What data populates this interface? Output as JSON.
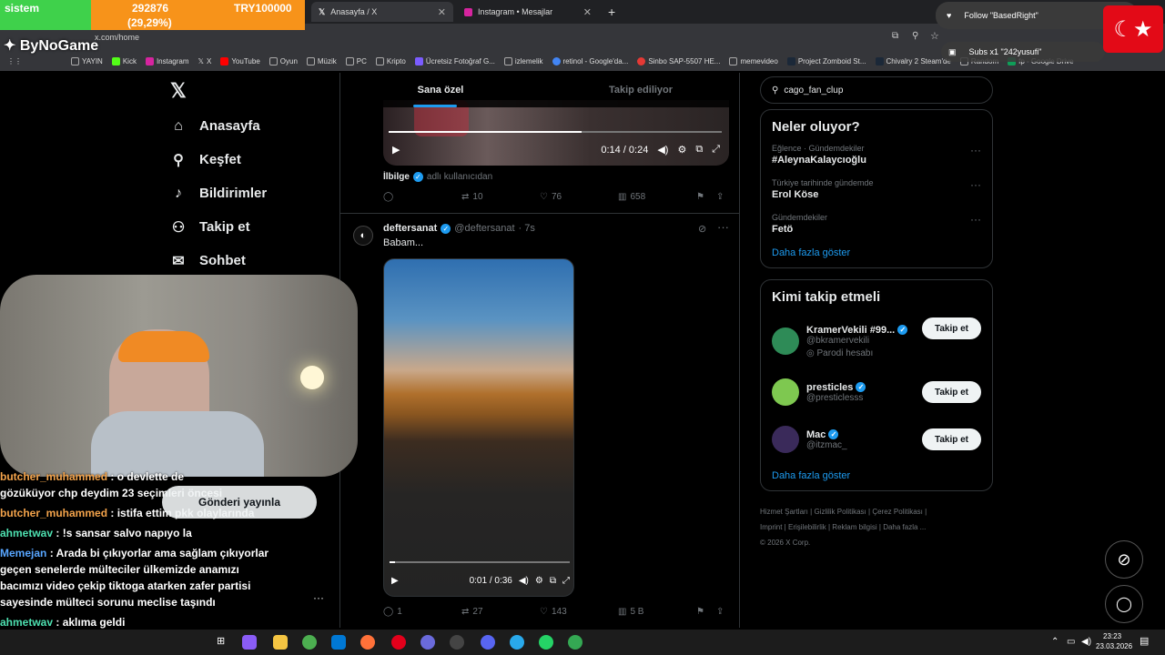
{
  "browser": {
    "tabs": [
      {
        "label": "Anasayfa / X",
        "active": true
      },
      {
        "label": "Instagram • Mesajlar",
        "active": false
      }
    ],
    "url": "x.com/home",
    "bookmarks": [
      "YAYIN",
      "Kick",
      "Instagram",
      "X",
      "YouTube",
      "Oyun",
      "Müzik",
      "PC",
      "Kripto",
      "Ücretsiz Fotoğraf G...",
      "izlemelik",
      "retinol - Google'da...",
      "Sinbo SAP-5507 HE...",
      "memevideo",
      "Project Zomboid St...",
      "Chivalry 2 Steam'de",
      "Random",
      "fp - Google Drive"
    ]
  },
  "overlay": {
    "ticker_label": "sistem",
    "ticker_value": "292876",
    "ticker_percent": "(29,29%)",
    "ticker_goal": "TRY100000",
    "channel": "ByNoGame",
    "follow_alert": "Follow \"BasedRight\"",
    "subs_alert": "Subs x1 \"242yusufi\""
  },
  "nav": {
    "items": [
      {
        "label": "Anasayfa",
        "icon": "home-icon"
      },
      {
        "label": "Keşfet",
        "icon": "search-icon"
      },
      {
        "label": "Bildirimler",
        "icon": "bell-icon"
      },
      {
        "label": "Takip et",
        "icon": "add-user-icon"
      },
      {
        "label": "Sohbet",
        "icon": "mail-icon"
      }
    ],
    "post_button": "Gönderi yayınla"
  },
  "feed": {
    "tabs": [
      "Sana özel",
      "Takip ediliyor"
    ],
    "post1": {
      "video_time": "0:14 / 0:24",
      "caption_name": "İlbilge",
      "caption_suffix": "adlı kullanıcıdan",
      "replies": "",
      "reposts": "10",
      "likes": "76",
      "views": "658"
    },
    "post2": {
      "author": "deftersanat",
      "handle": "@deftersanat",
      "time": "· 7s",
      "text": "Babam...",
      "video_time": "0:01 / 0:36",
      "replies": "1",
      "reposts": "27",
      "likes": "143",
      "views": "5 B"
    }
  },
  "sidebar": {
    "search_value": "cago_fan_clup",
    "trends_title": "Neler oluyor?",
    "trends": [
      {
        "context": "Eğlence · Gündemdekiler",
        "title": "#AleynaKalaycıoğlu"
      },
      {
        "context": "Türkiye tarihinde gündemde",
        "title": "Erol Köse"
      },
      {
        "context": "Gündemdekiler",
        "title": "Fetö"
      }
    ],
    "show_more": "Daha fazla göster",
    "who_title": "Kimi takip etmeli",
    "who": [
      {
        "name": "KramerVekili #99...",
        "handle": "@bkramervekili",
        "extra": "Parodi hesabı",
        "color": "#2e8b57"
      },
      {
        "name": "presticles",
        "handle": "@presticlesss",
        "extra": "",
        "color": "#7ec850"
      },
      {
        "name": "Mac",
        "handle": "@itzmac_",
        "extra": "",
        "color": "#3a2a5a"
      }
    ],
    "follow_label": "Takip et",
    "footer": [
      "Hizmet Şartları",
      "Gizlilik Politikası",
      "Çerez Politikası",
      "Imprint",
      "Erişilebilirlik",
      "Reklam bilgisi",
      "Daha fazla ...",
      "© 2026 X Corp."
    ]
  },
  "chat": [
    {
      "user": "butcher_muhammed",
      "text": ": o devlette de",
      "color": "u1"
    },
    {
      "user": "",
      "text": "gözüküyor chp deydim 23 seçimleri öncesi",
      "color": ""
    },
    {
      "user": "butcher_muhammed",
      "text": ": istifa ettim pkk olaylarında",
      "color": "u1"
    },
    {
      "user": "ahmetwav",
      "text": ": !s sansar salvo napıyo la",
      "color": "u2"
    },
    {
      "user": "Memejan",
      "text": ": Arada bi çıkıyorlar ama sağlam çıkıyorlar geçen senelerde mülteciler ülkemizde anamızı bacımızı video çekip tiktoga atarken zafer partisi sayesinde mülteci sorunu meclise taşındı",
      "color": "u3"
    },
    {
      "user": "ahmetwav",
      "text": ": aklıma geldi",
      "color": "u2"
    }
  ],
  "taskbar": {
    "time": "23:23",
    "date": "23.03.2026"
  }
}
